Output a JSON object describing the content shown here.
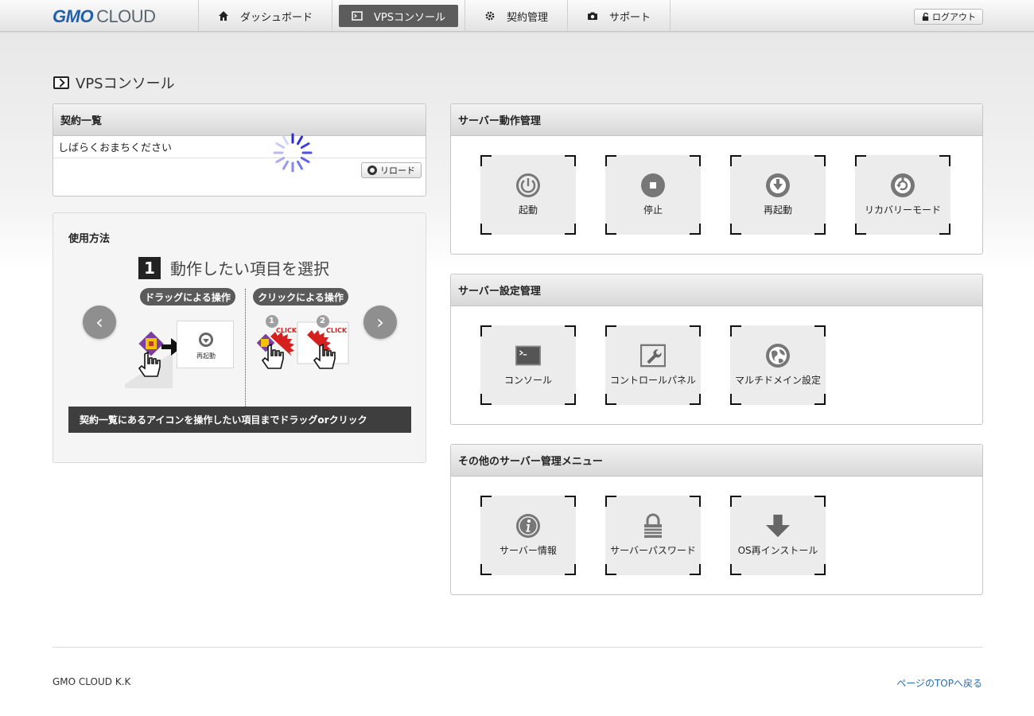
{
  "brand": {
    "gmo": "GMO",
    "cloud": "CLOUD"
  },
  "nav": {
    "items": [
      {
        "label": "ダッシュボード",
        "icon": "home-icon"
      },
      {
        "label": "VPSコンソール",
        "icon": "terminal-icon",
        "active": true
      },
      {
        "label": "契約管理",
        "icon": "gear-icon"
      },
      {
        "label": "サポート",
        "icon": "camera-icon"
      }
    ],
    "logout_label": "ログアウト"
  },
  "page_title": "VPSコンソール",
  "contracts": {
    "title": "契約一覧",
    "loading_text": "しばらくおまちください",
    "reload_label": "リロード"
  },
  "usage": {
    "title": "使用方法",
    "step_number": "1",
    "step_text": "動作したい項目を選択",
    "drag_tag": "ドラッグによる操作",
    "click_tag": "クリックによる操作",
    "demo_label": "再起動",
    "click_text": "CLICK",
    "click_num_1": "1",
    "click_num_2": "2",
    "caption": "契約一覧にあるアイコンを操作したい項目までドラッグorクリック",
    "prev_symbol": "‹",
    "next_symbol": "›"
  },
  "server_ops": {
    "title": "サーバー動作管理",
    "tiles": [
      {
        "label": "起動",
        "icon": "power-icon"
      },
      {
        "label": "停止",
        "icon": "stop-icon"
      },
      {
        "label": "再起動",
        "icon": "restart-icon"
      },
      {
        "label": "リカバリーモード",
        "icon": "recovery-icon"
      }
    ]
  },
  "server_settings": {
    "title": "サーバー設定管理",
    "tiles": [
      {
        "label": "コンソール",
        "icon": "console-icon"
      },
      {
        "label": "コントロールパネル",
        "icon": "wrench-icon"
      },
      {
        "label": "マルチドメイン設定",
        "icon": "globe-icon"
      }
    ]
  },
  "other_menu": {
    "title": "その他のサーバー管理メニュー",
    "tiles": [
      {
        "label": "サーバー情報",
        "icon": "info-icon"
      },
      {
        "label": "サーバーパスワード",
        "icon": "lock-icon"
      },
      {
        "label": "OS再インストール",
        "icon": "download-icon"
      }
    ]
  },
  "footer": {
    "company": "GMO CLOUD K.K",
    "to_top": "ページのTOPへ戻る"
  },
  "colors": {
    "brand_blue": "#1f5fae",
    "nav_active": "#5c5c5c",
    "link": "#2a6db5",
    "spinner": "#3a3ae0"
  }
}
